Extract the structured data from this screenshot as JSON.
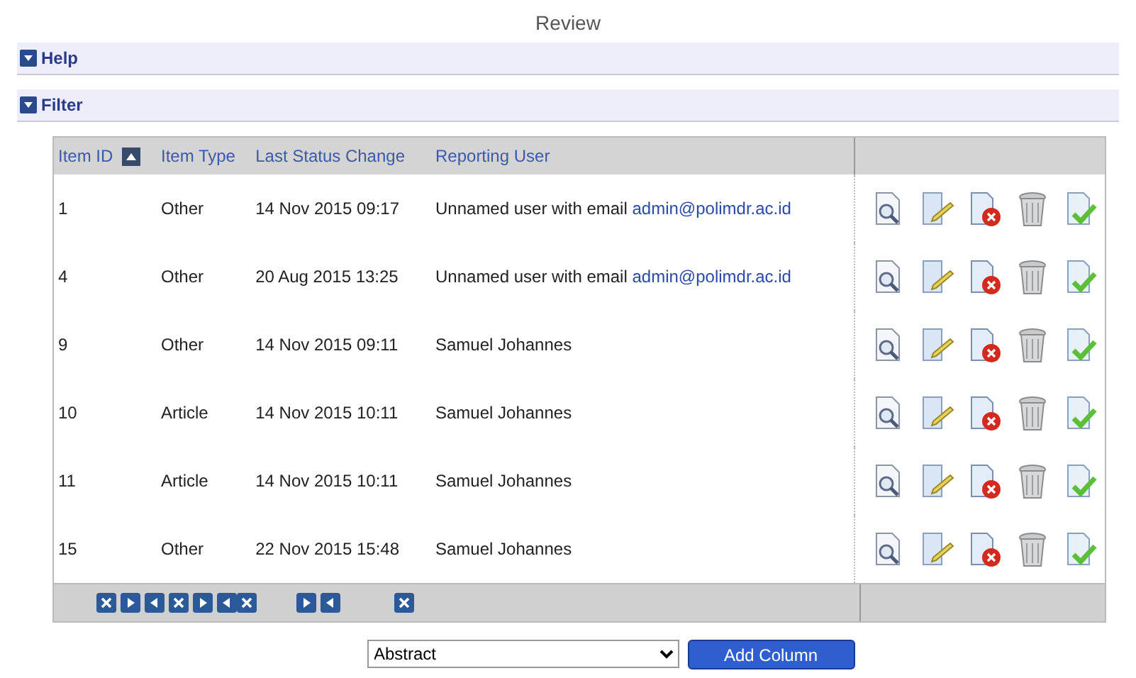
{
  "title": "Review",
  "sections": [
    {
      "label": "Help"
    },
    {
      "label": "Filter"
    }
  ],
  "table": {
    "columns": [
      {
        "label": "Item ID",
        "sortable": true
      },
      {
        "label": "Item Type",
        "sortable": false
      },
      {
        "label": "Last Status Change",
        "sortable": false
      },
      {
        "label": "Reporting User",
        "sortable": false
      }
    ],
    "rows": [
      {
        "id": "1",
        "type": "Other",
        "changed": "14 Nov 2015 09:17",
        "user": "Unnamed user with email ",
        "email": "admin@polimdr.ac.id"
      },
      {
        "id": "4",
        "type": "Other",
        "changed": "20 Aug 2015 13:25",
        "user": "Unnamed user with email ",
        "email": "admin@polimdr.ac.id"
      },
      {
        "id": "9",
        "type": "Other",
        "changed": "14 Nov 2015 09:11",
        "user": "Samuel Johannes"
      },
      {
        "id": "10",
        "type": "Article",
        "changed": "14 Nov 2015 10:11",
        "user": "Samuel Johannes"
      },
      {
        "id": "11",
        "type": "Article",
        "changed": "14 Nov 2015 10:11",
        "user": "Samuel Johannes"
      },
      {
        "id": "15",
        "type": "Other",
        "changed": "22 Nov 2015 15:48",
        "user": "Samuel Johannes"
      }
    ],
    "footer_controls": [
      {
        "kind": "buttons"
      }
    ]
  },
  "add_column": {
    "value": "Abstract",
    "button": "Add Column"
  }
}
